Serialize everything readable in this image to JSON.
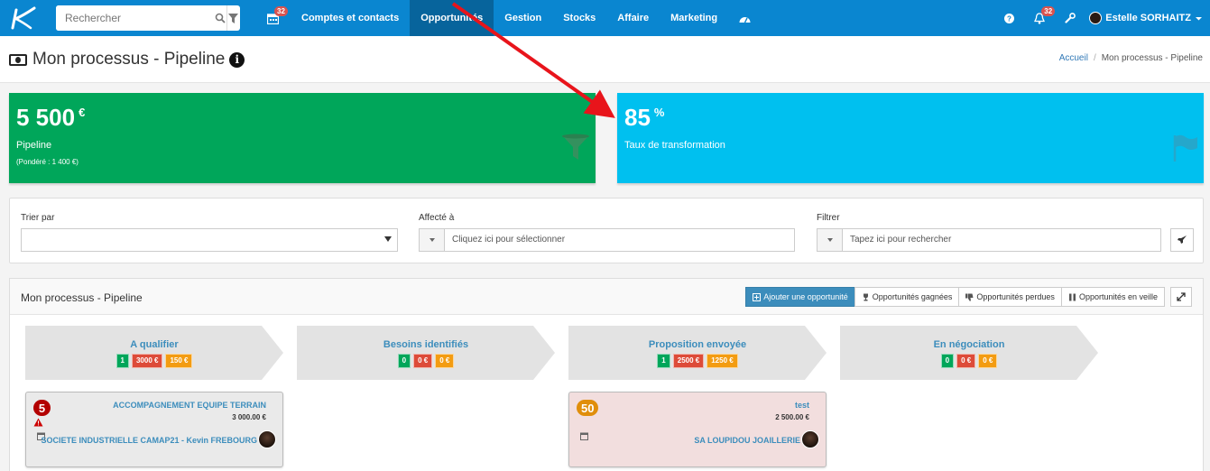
{
  "nav": {
    "search_placeholder": "Rechercher",
    "calendar_badge": "32",
    "items": [
      {
        "label": "Comptes et contacts",
        "active": false
      },
      {
        "label": "Opportunités",
        "active": true
      },
      {
        "label": "Gestion",
        "active": false
      },
      {
        "label": "Stocks",
        "active": false
      },
      {
        "label": "Affaire",
        "active": false
      },
      {
        "label": "Marketing",
        "active": false
      }
    ],
    "notifications_badge": "32",
    "user_name": "Estelle SORHAITZ"
  },
  "header": {
    "title": "Mon processus - Pipeline",
    "breadcrumb_home": "Accueil",
    "breadcrumb_current": "Mon processus - Pipeline"
  },
  "kpis": {
    "pipeline": {
      "value": "5 500",
      "unit": "€",
      "label": "Pipeline",
      "sub": "(Pondéré : 1 400 €)",
      "color": "#00a65a"
    },
    "conversion": {
      "value": "85",
      "unit": "%",
      "label": "Taux de transformation",
      "color": "#00c0ef"
    }
  },
  "filters": {
    "sort_label": "Trier par",
    "sort_value": "",
    "assigned_label": "Affecté à",
    "assigned_placeholder": "Cliquez ici pour sélectionner",
    "filter_label": "Filtrer",
    "filter_placeholder": "Tapez ici pour rechercher"
  },
  "pipeline": {
    "title": "Mon processus - Pipeline",
    "buttons": {
      "add": "Ajouter une opportunité",
      "won": "Opportunités gagnées",
      "lost": "Opportunités perdues",
      "standby": "Opportunités en veille"
    },
    "stages": [
      {
        "name": "A qualifier",
        "count": "1",
        "amount": "3000 €",
        "weighted": "150 €"
      },
      {
        "name": "Besoins identifiés",
        "count": "0",
        "amount": "0 €",
        "weighted": "0 €"
      },
      {
        "name": "Proposition envoyée",
        "count": "1",
        "amount": "2500 €",
        "weighted": "1250 €"
      },
      {
        "name": "En négociation",
        "count": "0",
        "amount": "0 €",
        "weighted": "0 €"
      }
    ],
    "cards": [
      {
        "probability": "5",
        "title": "ACCOMPAGNEMENT EQUIPE TERRAIN",
        "amount": "3 000.00 €",
        "company": "SOCIETE INDUSTRIELLE CAMAP21 - Kevin FREBOURG"
      },
      {
        "probability": "50",
        "title": "test",
        "amount": "2 500.00 €",
        "company": "SA LOUPIDOU JOAILLERIE"
      }
    ]
  },
  "colors": {
    "navbar": "#0a86d0",
    "navbar_active": "#07649c",
    "link": "#3c8dbc",
    "annotation_arrow": "#e8141b"
  }
}
